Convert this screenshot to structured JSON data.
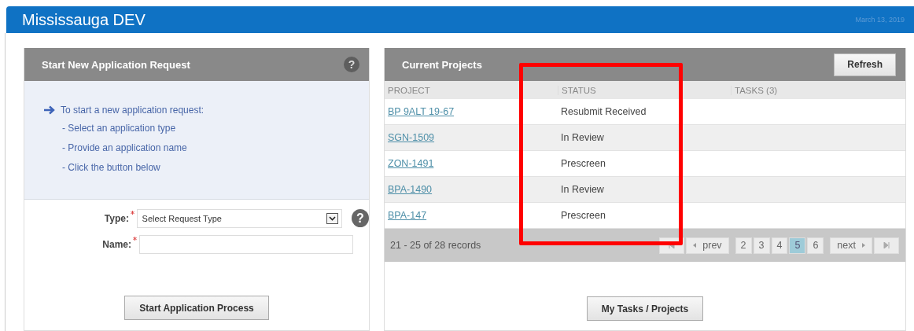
{
  "header": {
    "title": "Mississauga DEV",
    "date": "March 13, 2019"
  },
  "new_request": {
    "title": "Start New Application Request",
    "help": "?",
    "intro": "To start a new application request:",
    "steps": [
      "- Select an application type",
      "- Provide an application name",
      "- Click the button below"
    ],
    "type_field": {
      "label": "Type:",
      "required": true,
      "placeholder": "Select Request Type",
      "help": "?"
    },
    "name_field": {
      "label": "Name:",
      "required": true
    },
    "button": "Start Application Process"
  },
  "current_projects": {
    "title": "Current Projects",
    "refresh": "Refresh",
    "columns": [
      "PROJECT",
      "STATUS",
      "TASKS (3)"
    ],
    "rows": [
      {
        "project": "BP 9ALT 19-67",
        "status": "Resubmit Received"
      },
      {
        "project": "SGN-1509",
        "status": "In Review"
      },
      {
        "project": "ZON-1491",
        "status": "Prescreen"
      },
      {
        "project": "BPA-1490",
        "status": "In Review"
      },
      {
        "project": "BPA-147",
        "status": "Prescreen"
      }
    ],
    "records": "21 - 25 of 28 records",
    "pagination": {
      "prev": "prev",
      "next": "next",
      "pages": [
        {
          "label": "2",
          "selected": false
        },
        {
          "label": "3",
          "selected": false
        },
        {
          "label": "4",
          "selected": false
        },
        {
          "label": "5",
          "selected": true
        },
        {
          "label": "6",
          "selected": false
        }
      ]
    },
    "button": "My Tasks / Projects"
  }
}
